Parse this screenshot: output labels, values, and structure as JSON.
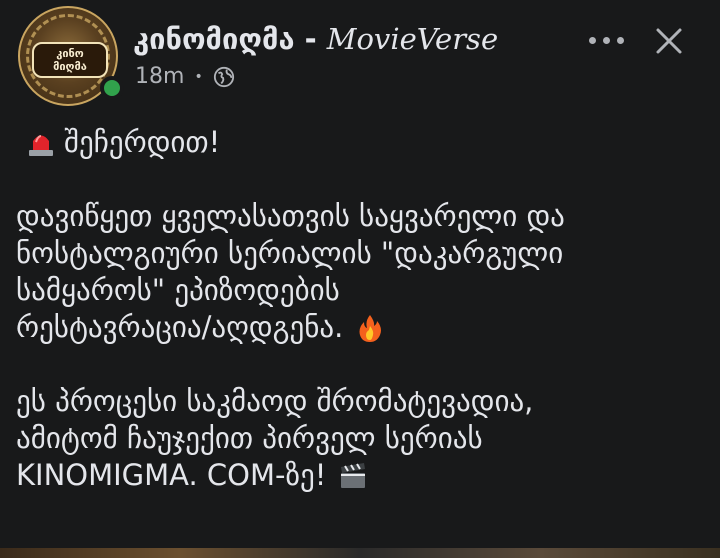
{
  "post": {
    "author_name": "კინომიღმა - ",
    "author_brand": "MovieVerse",
    "time": "18m",
    "separator": "•",
    "avatar_text_top": "კინო",
    "avatar_text_bottom": "მიღმა",
    "privacy_icon": "globe-icon",
    "more_icon": "more-options-icon",
    "close_icon": "close-icon",
    "online_color": "#31a24c"
  },
  "text": {
    "line1": "შეჩერდით!",
    "line1_emoji": "siren-icon",
    "line2": "დავიწყეთ ყველასათვის საყვარელი და",
    "line3": "ნოსტალგიური სერიალის \"დაკარგული",
    "line4": "სამყაროს\" ეპიზოდების",
    "line5": "რესტავრაცია/აღდგენა.",
    "line5_emoji": "fire-icon",
    "line6": "ეს პროცესი საკმაოდ შრომატევადია,",
    "line7": "ამიტომ ჩაუჯექით პირველ სერიას",
    "line8": "KINOMIGMA. COM-ზე!",
    "line8_emoji": "clapperboard-icon"
  }
}
